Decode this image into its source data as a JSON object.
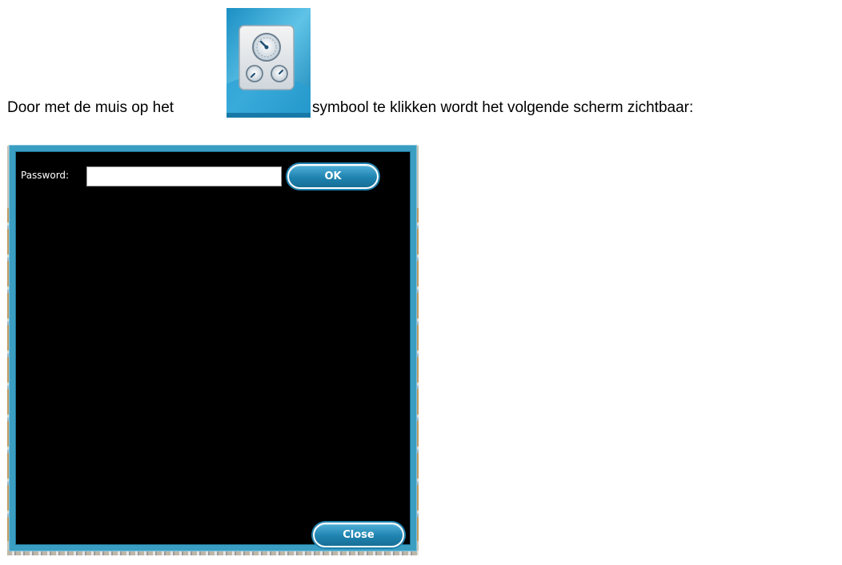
{
  "intro": {
    "text_before": "Door met de muis op het",
    "text_after": "symbool te klikken wordt het volgende scherm zichtbaar:",
    "icon": "gauge-dashboard-icon"
  },
  "dialog": {
    "password_label": "Password:",
    "password_value": "",
    "ok_label": "OK",
    "close_label": "Close"
  },
  "colors": {
    "frame": "#3a9ec2",
    "background": "#000000",
    "button": "#1f83b0"
  }
}
